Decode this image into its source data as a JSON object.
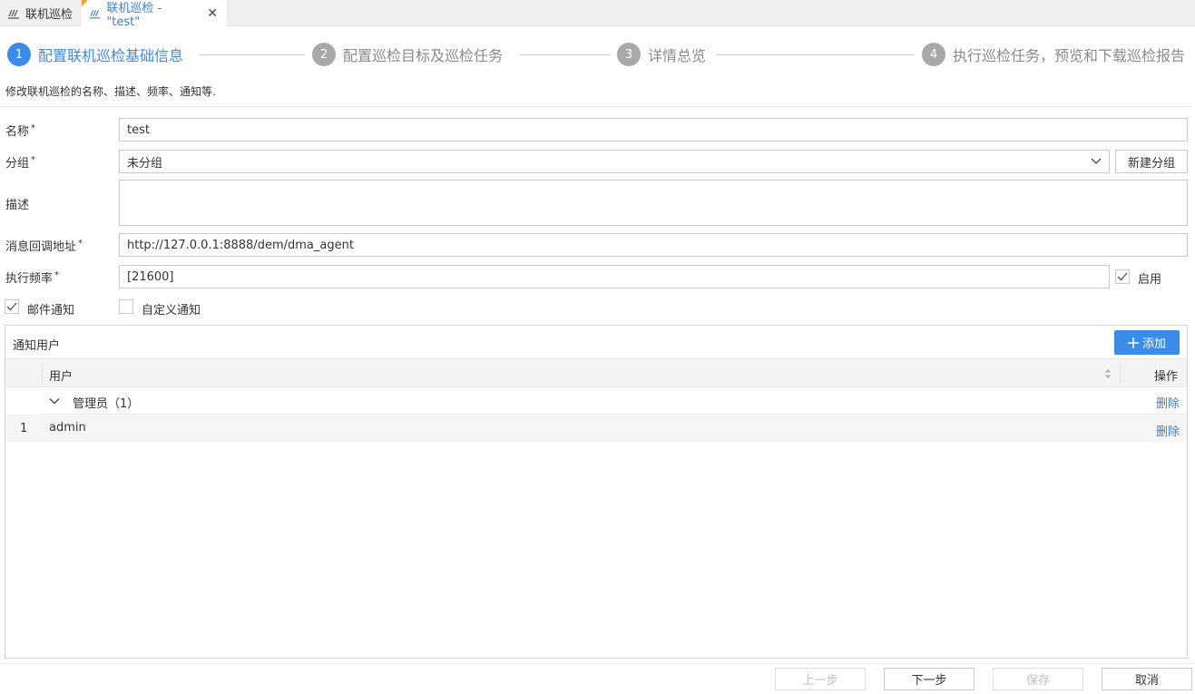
{
  "tabs": [
    {
      "label": "联机巡检",
      "icon": "inspection-icon"
    },
    {
      "label": "联机巡检 - \"test\"",
      "icon": "inspection-icon",
      "close": "✕"
    }
  ],
  "steps": [
    {
      "num": "1",
      "label": "配置联机巡检基础信息"
    },
    {
      "num": "2",
      "label": "配置巡检目标及巡检任务"
    },
    {
      "num": "3",
      "label": "详情总览"
    },
    {
      "num": "4",
      "label": "执行巡检任务，预览和下载巡检报告"
    }
  ],
  "hint": "修改联机巡检的名称、描述、频率、通知等.",
  "form": {
    "name_label": "名称",
    "name_value": "test",
    "group_label": "分组",
    "group_value": "未分组",
    "new_group_button": "新建分组",
    "desc_label": "描述",
    "desc_value": "",
    "callback_label": "消息回调地址",
    "callback_value": "http://127.0.0.1:8888/dem/dma_agent",
    "freq_label": "执行频率",
    "freq_value": "[21600]",
    "enable_label": "启用",
    "email_notify_label": "邮件通知",
    "custom_notify_label": "自定义通知",
    "required_mark": "*"
  },
  "notify": {
    "title": "通知用户",
    "add_button": "添加",
    "col_user": "用户",
    "col_op": "操作",
    "group_row": "管理员（1）",
    "group_delete": "删除",
    "rows": [
      {
        "num": "1",
        "name": "admin",
        "delete": "删除"
      }
    ]
  },
  "footer": {
    "prev": "上一步",
    "next": "下一步",
    "save": "保存",
    "cancel": "取消"
  },
  "colors": {
    "accent": "#3b8beb",
    "link": "#3b7ddd",
    "step_inactive": "#a8a8a8"
  }
}
